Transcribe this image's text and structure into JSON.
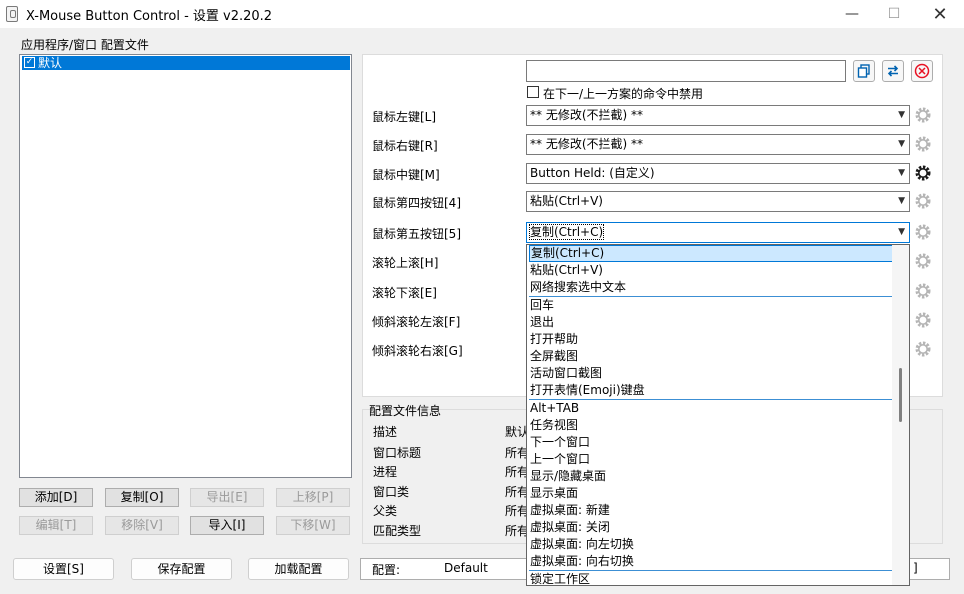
{
  "window": {
    "title": "X-Mouse Button Control - 设置 v2.20.2",
    "minimize_glyph": "—",
    "maximize_glyph": "☐",
    "close_glyph": "✕"
  },
  "apps": {
    "group_label": "应用程序/窗口 配置文件",
    "items": [
      {
        "label": "默认",
        "checked": true
      }
    ],
    "buttons": {
      "add": "添加[D]",
      "copy": "复制[O]",
      "export": "导出[E]",
      "move_up": "上移[P]",
      "edit": "编辑[T]",
      "remove": "移除[V]",
      "import": "导入[I]",
      "move_down": "下移[W]"
    }
  },
  "profile": {
    "name_value": "",
    "disable_label": "在下一/上一方案的命令中禁用",
    "disable_checked": false
  },
  "mappings": [
    {
      "label": "鼠标左键[L]",
      "value": "** 无修改(不拦截) **"
    },
    {
      "label": "鼠标右键[R]",
      "value": "** 无修改(不拦截) **"
    },
    {
      "label": "鼠标中键[M]",
      "value": "Button Held: (自定义)"
    },
    {
      "label": "鼠标第四按钮[4]",
      "value": "粘贴(Ctrl+V)"
    },
    {
      "label": "鼠标第五按钮[5]",
      "value": "复制(Ctrl+C)"
    },
    {
      "label": "滚轮上滚[H]"
    },
    {
      "label": "滚轮下滚[E]"
    },
    {
      "label": "倾斜滚轮左滚[F]"
    },
    {
      "label": "倾斜滚轮右滚[G]"
    }
  ],
  "dropdown": {
    "items": [
      "复制(Ctrl+C)",
      "粘贴(Ctrl+V)",
      "网络搜索选中文本",
      "回车",
      "退出",
      "打开帮助",
      "全屏截图",
      "活动窗口截图",
      "打开表情(Emoji)键盘",
      "Alt+TAB",
      "任务视图",
      "下一个窗口",
      "上一个窗口",
      "显示/隐藏桌面",
      "显示桌面",
      "虚拟桌面: 新建",
      "虚拟桌面: 关闭",
      "虚拟桌面: 向左切换",
      "虚拟桌面: 向右切换",
      "锁定工作区"
    ],
    "selected_index": 0
  },
  "info": {
    "group_label": "配置文件信息",
    "rows": [
      {
        "label": "描述",
        "value": "默认"
      },
      {
        "label": "窗口标题",
        "value": "所有"
      },
      {
        "label": "进程",
        "value": "所有"
      },
      {
        "label": "窗口类",
        "value": "所有"
      },
      {
        "label": "父类",
        "value": "所有"
      },
      {
        "label": "匹配类型",
        "value": "所有"
      }
    ]
  },
  "footer": {
    "settings": "设置[S]",
    "save": "保存配置",
    "load": "加载配置",
    "profile_label": "配置:",
    "profile_value": "Default",
    "tail": "]"
  },
  "colors": {
    "accent": "#0078d7",
    "selection_bg": "#cce8ff",
    "red_cancel": "#e81123",
    "blue_swap": "#0063b1"
  }
}
